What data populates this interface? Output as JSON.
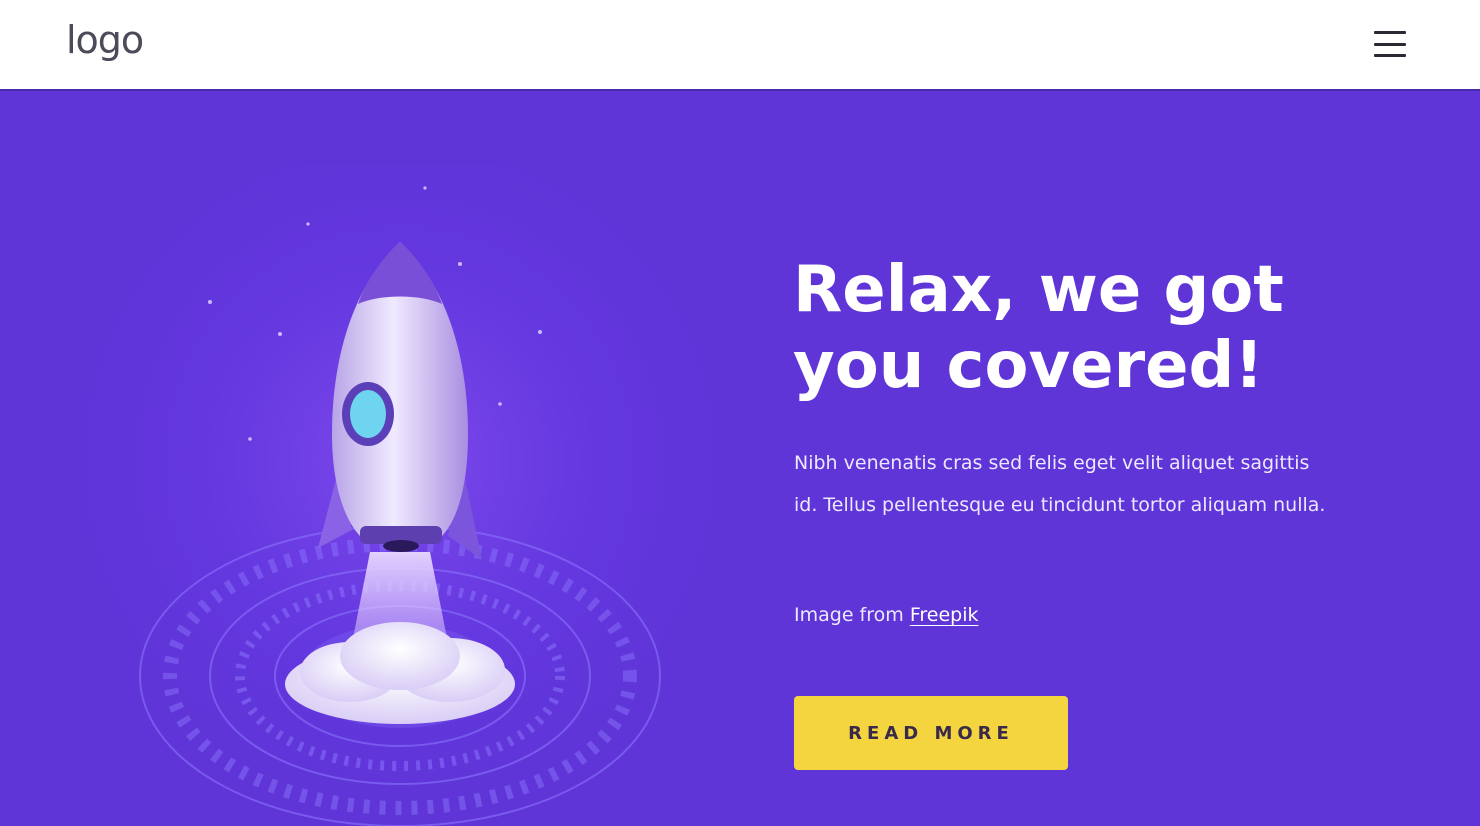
{
  "header": {
    "logo_text": "logo",
    "menu_icon": "hamburger-menu-icon"
  },
  "hero": {
    "title": "Relax, we got you covered!",
    "description": "Nibh venenatis cras sed felis eget velit aliquet sagittis id. Tellus pellentesque eu tincidunt tortor aliquam nulla.",
    "credit_prefix": "Image from",
    "credit_link": "Freepik",
    "cta_label": "READ MORE",
    "illustration": "rocket-launch-illustration"
  },
  "colors": {
    "hero_background": "#5f35d8",
    "cta_background": "#f4d53f",
    "header_background": "#ffffff",
    "text_light": "#ffffff"
  }
}
